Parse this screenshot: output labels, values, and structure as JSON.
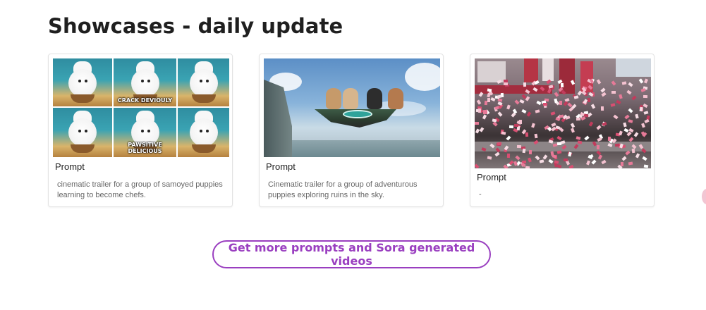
{
  "page": {
    "title": "Showcases - daily update"
  },
  "cards": [
    {
      "prompt_label": "Prompt",
      "prompt_text": "cinematic trailer for a group of samoyed puppies learning to become chefs.",
      "captions": [
        "CRACK DEVIOULY",
        "PAWSITIVE DELICIOUS"
      ],
      "thumbnail": "samoyed-chef-puppies-grid"
    },
    {
      "prompt_label": "Prompt",
      "prompt_text": "Cinematic trailer for a group of adventurous puppies exploring ruins in the sky.",
      "thumbnail": "puppies-floating-island"
    },
    {
      "prompt_label": "Prompt",
      "prompt_text": "-",
      "thumbnail": "city-confetti-street"
    }
  ],
  "cta": {
    "label": "Get more prompts and Sora generated videos"
  },
  "colors": {
    "accent": "#9a3fc0"
  }
}
